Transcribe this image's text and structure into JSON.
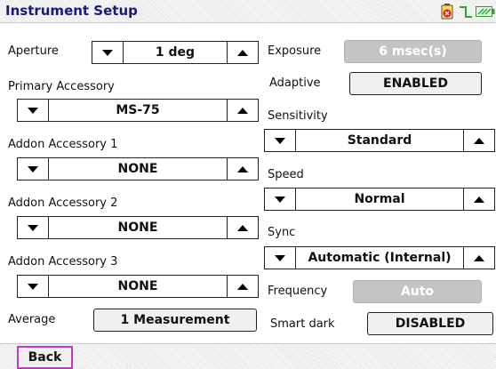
{
  "window": {
    "title": "Instrument Setup"
  },
  "status_icons": [
    {
      "name": "battery-icon",
      "color": "#d42020"
    },
    {
      "name": "signal-icon",
      "color": "#28a828"
    },
    {
      "name": "power-icon",
      "color": "#28a828"
    }
  ],
  "left": {
    "aperture": {
      "label": "Aperture",
      "value": "1 deg"
    },
    "primary_accessory": {
      "label": "Primary Accessory",
      "value": "MS-75"
    },
    "addon1": {
      "label": "Addon Accessory 1",
      "value": "NONE"
    },
    "addon2": {
      "label": "Addon Accessory 2",
      "value": "NONE"
    },
    "addon3": {
      "label": "Addon Accessory 3",
      "value": "NONE"
    },
    "average": {
      "label": "Average",
      "value": "1 Measurement"
    }
  },
  "right": {
    "exposure": {
      "label": "Exposure",
      "value": "6 msec(s)"
    },
    "adaptive": {
      "label": "Adaptive",
      "value": "ENABLED"
    },
    "sensitivity": {
      "label": "Sensitivity",
      "value": "Standard"
    },
    "speed": {
      "label": "Speed",
      "value": "Normal"
    },
    "sync": {
      "label": "Sync",
      "value": "Automatic (Internal)"
    },
    "frequency": {
      "label": "Frequency",
      "value": "Auto"
    },
    "smart_dark": {
      "label": "Smart dark",
      "value": "DISABLED"
    }
  },
  "footer": {
    "back_label": "Back"
  }
}
